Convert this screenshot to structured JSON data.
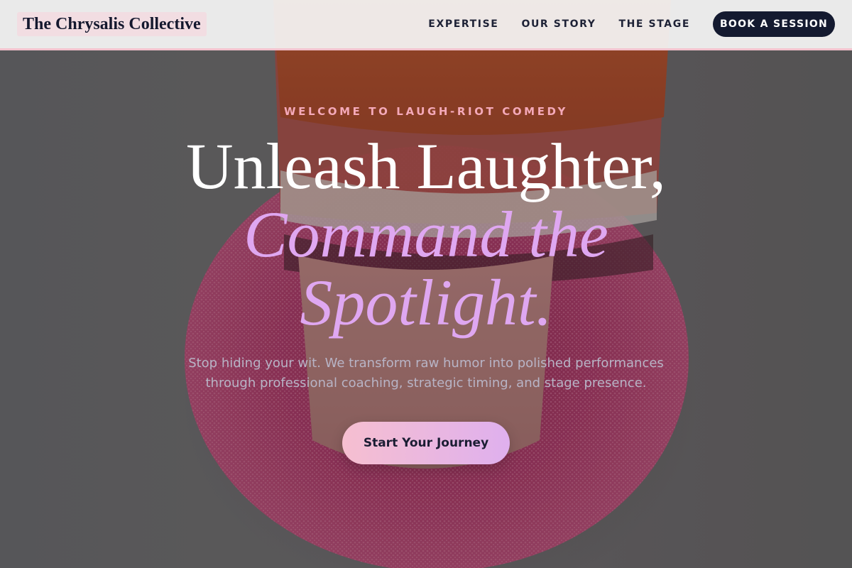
{
  "brand": {
    "name": "The Chrysalis Collective"
  },
  "nav": {
    "links": [
      {
        "label": "EXPERTISE"
      },
      {
        "label": "OUR STORY"
      },
      {
        "label": "THE STAGE"
      }
    ],
    "cta_label": "BOOK A SESSION"
  },
  "hero": {
    "eyebrow": "WELCOME TO LAUGH-RIOT COMEDY",
    "headline_line1": "Unleash Laughter,",
    "headline_accent_line1": "Command the",
    "headline_accent_line2": "Spotlight.",
    "subtext": "Stop hiding your wit. We transform raw humor into polished performances through professional coaching, strategic timing, and stage presence.",
    "cta_label": "Start Your Journey"
  },
  "colors": {
    "nav_background": "#f5f5f5",
    "nav_border": "#f3c4cf",
    "brand_highlight": "#f2dde2",
    "dark_navy": "#141a30",
    "eyebrow_pink": "#f4a9b9",
    "headline_accent_lavender": "#dfa7f1",
    "cta_gradient_start": "#f6bfd0",
    "cta_gradient_end": "#dfb0ee"
  }
}
